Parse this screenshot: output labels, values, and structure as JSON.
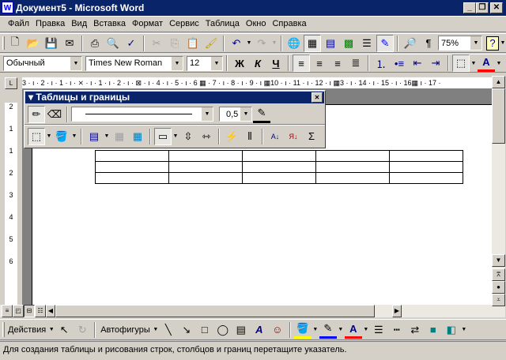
{
  "window": {
    "title": "Документ5 - Microsoft Word",
    "icon": "word-doc-icon"
  },
  "menu": [
    "Файл",
    "Правка",
    "Вид",
    "Вставка",
    "Формат",
    "Сервис",
    "Таблица",
    "Окно",
    "Справка"
  ],
  "standard_toolbar": {
    "zoom": "75%",
    "icons": [
      "new-icon",
      "open-icon",
      "save-icon",
      "email-icon",
      "print-icon",
      "print-preview-icon",
      "spelling-icon",
      "cut-icon",
      "copy-icon",
      "paste-icon",
      "format-painter-icon",
      "undo-icon",
      "redo-icon",
      "hyperlink-icon",
      "tables-borders-icon",
      "insert-table-icon",
      "insert-excel-icon",
      "columns-icon",
      "drawing-icon",
      "document-map-icon",
      "show-formatting-icon",
      "help-icon"
    ]
  },
  "formatting_toolbar": {
    "style": "Обычный",
    "font": "Times New Roman",
    "size": "12",
    "bold": "Ж",
    "italic": "К",
    "underline": "Ч",
    "font_color_letter": "A",
    "font_color": "#ff0000"
  },
  "ruler": {
    "labels": "3 · ı · 2 · ı · 1 · ı · ⨯ · ı · 1 · ı · 2 · ı · ⊠ · ı · 4 · ı · 5 · ı · 6 ▦ · 7 · ı · 8 · ı · 9 · ı ▦10 · ı · 11 · ı · 12 · ı ▦3 · ı · 14 · ı · 15 · ı · 16▦ ı · 17 ·"
  },
  "vruler": {
    "labels": [
      "2",
      "1",
      "1",
      "2",
      "3",
      "4",
      "5",
      "6"
    ]
  },
  "tables_toolbar": {
    "title": "Таблицы и границы",
    "line_weight": "0,5",
    "sum": "Σ"
  },
  "table": {
    "rows": 3,
    "cols": 5
  },
  "drawing_toolbar": {
    "actions": "Действия",
    "autoshapes": "Автофигуры",
    "fill_color": "#ffff00",
    "line_color": "#0000ff",
    "font_color": "#ff0000",
    "text_a": "A"
  },
  "status": "Для создания таблицы и рисования строк, столбцов и границ перетащите указатель."
}
